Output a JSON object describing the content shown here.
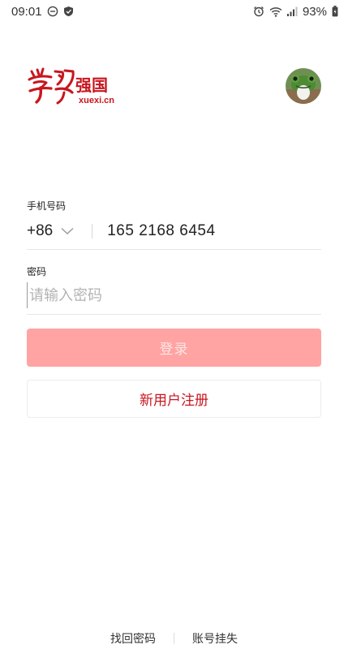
{
  "status_bar": {
    "time": "09:01",
    "battery": "93%",
    "icons": [
      "dnd-icon",
      "shield-icon",
      "alarm-icon",
      "wifi-icon",
      "signal-icon",
      "battery-icon"
    ]
  },
  "header": {
    "logo_text": "学习强国",
    "logo_domain": "xuexi.cn",
    "avatar": "frog-avatar"
  },
  "form": {
    "phone_label": "手机号码",
    "country_code": "+86",
    "phone_number": "165 2168 6454",
    "password_label": "密码",
    "password_placeholder": "请输入密码",
    "login_label": "登录",
    "register_label": "新用户注册"
  },
  "footer": {
    "recover_password": "找回密码",
    "report_loss": "账号挂失"
  },
  "colors": {
    "brand_red": "#c8161e",
    "login_button_bg": "#ffa3a3",
    "login_button_text": "#ffe4e4"
  }
}
